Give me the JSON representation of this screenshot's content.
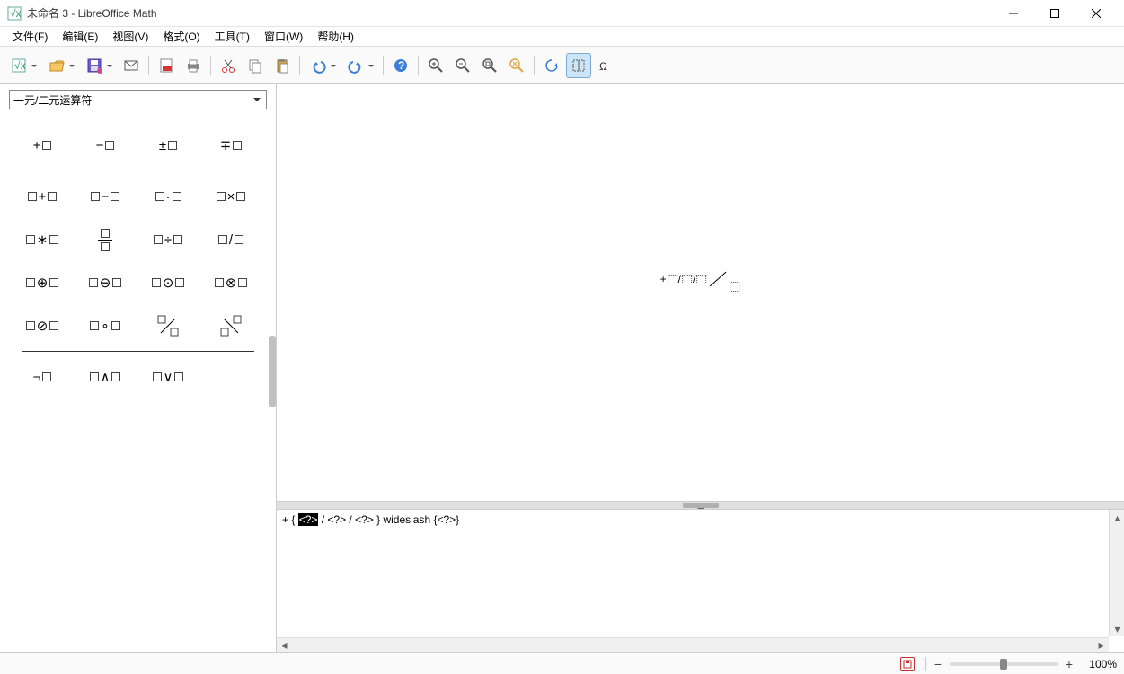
{
  "titlebar": {
    "title": "未命名 3 - LibreOffice Math"
  },
  "menubar": {
    "items": [
      {
        "label": "文件(F)"
      },
      {
        "label": "编辑(E)"
      },
      {
        "label": "视图(V)"
      },
      {
        "label": "格式(O)"
      },
      {
        "label": "工具(T)"
      },
      {
        "label": "窗口(W)"
      },
      {
        "label": "帮助(H)"
      }
    ]
  },
  "toolbar": {
    "icons": [
      "new-math",
      "open",
      "save",
      "mail",
      "sep",
      "export-pdf",
      "print",
      "sep",
      "cut",
      "copy",
      "paste",
      "sep",
      "undo",
      "redo",
      "sep",
      "help",
      "sep",
      "zoom-in",
      "zoom-out",
      "zoom-page",
      "zoom-optimal",
      "sep",
      "refresh",
      "formula-cursor",
      "special-char"
    ]
  },
  "sidebar": {
    "category": "一元/二元运算符",
    "rows_group1": [
      [
        "+□",
        "−□",
        "±□",
        "∓□"
      ]
    ],
    "rows_group2": [
      [
        "□+□",
        "□−□",
        "□·□",
        "□×□"
      ],
      [
        "□∗□",
        "frac",
        "□÷□",
        "□/□"
      ],
      [
        "□⊕□",
        "□⊖□",
        "□⊙□",
        "□⊗□"
      ],
      [
        "□⊘□",
        "□∘□",
        "wideslash",
        "widebslash"
      ]
    ],
    "rows_group3": [
      [
        "¬□",
        "□∧□",
        "□∨□"
      ]
    ]
  },
  "preview": {
    "formula_text": "+□/□/□/□"
  },
  "editor": {
    "prefix": "+ { ",
    "selected": "<?>",
    "suffix": " / <?>  / <?> } wideslash {<?>}"
  },
  "statusbar": {
    "zoom_pct": "100%"
  }
}
